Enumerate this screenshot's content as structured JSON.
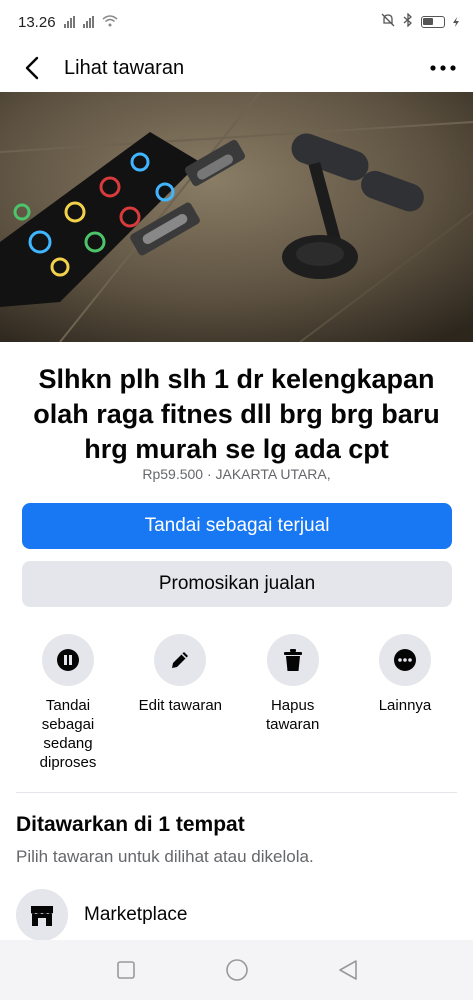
{
  "status_bar": {
    "time": "13.26",
    "icons": [
      "signal-icon",
      "signal-icon",
      "wifi-icon",
      "silent-icon",
      "bluetooth-icon",
      "battery-icon"
    ]
  },
  "header": {
    "title": "Lihat tawaran",
    "back_icon": "chevron-left-icon",
    "more_icon": "more-horizontal-icon"
  },
  "photo": {
    "slide_count": 7,
    "active_index": 0
  },
  "listing": {
    "title": "Slhkn plh slh 1 dr kelengkapan olah raga fitnes dll brg brg baru hrg murah se lg ada cpt",
    "meta": "Rp59.500 · JAKARTA UTARA,"
  },
  "buttons": {
    "mark_sold": "Tandai sebagai terjual",
    "promote": "Promosikan jualan"
  },
  "actions": [
    {
      "label": "Tandai sebagai sedang diproses",
      "icon": "pause-icon"
    },
    {
      "label": "Edit tawaran",
      "icon": "pencil-icon"
    },
    {
      "label": "Hapus tawaran",
      "icon": "trash-icon"
    },
    {
      "label": "Lainnya",
      "icon": "more-horizontal-icon"
    }
  ],
  "offered": {
    "title": "Ditawarkan di 1 tempat",
    "subtitle": "Pilih tawaran untuk dilihat atau dikelola.",
    "places": [
      {
        "label": "Marketplace",
        "icon": "store-icon"
      }
    ]
  },
  "nav": {
    "icons": [
      "recents-square-icon",
      "home-circle-icon",
      "back-triangle-icon"
    ]
  },
  "colors": {
    "primary": "#1877f2",
    "secondary_bg": "#e4e6eb",
    "muted_text": "#65676b"
  }
}
